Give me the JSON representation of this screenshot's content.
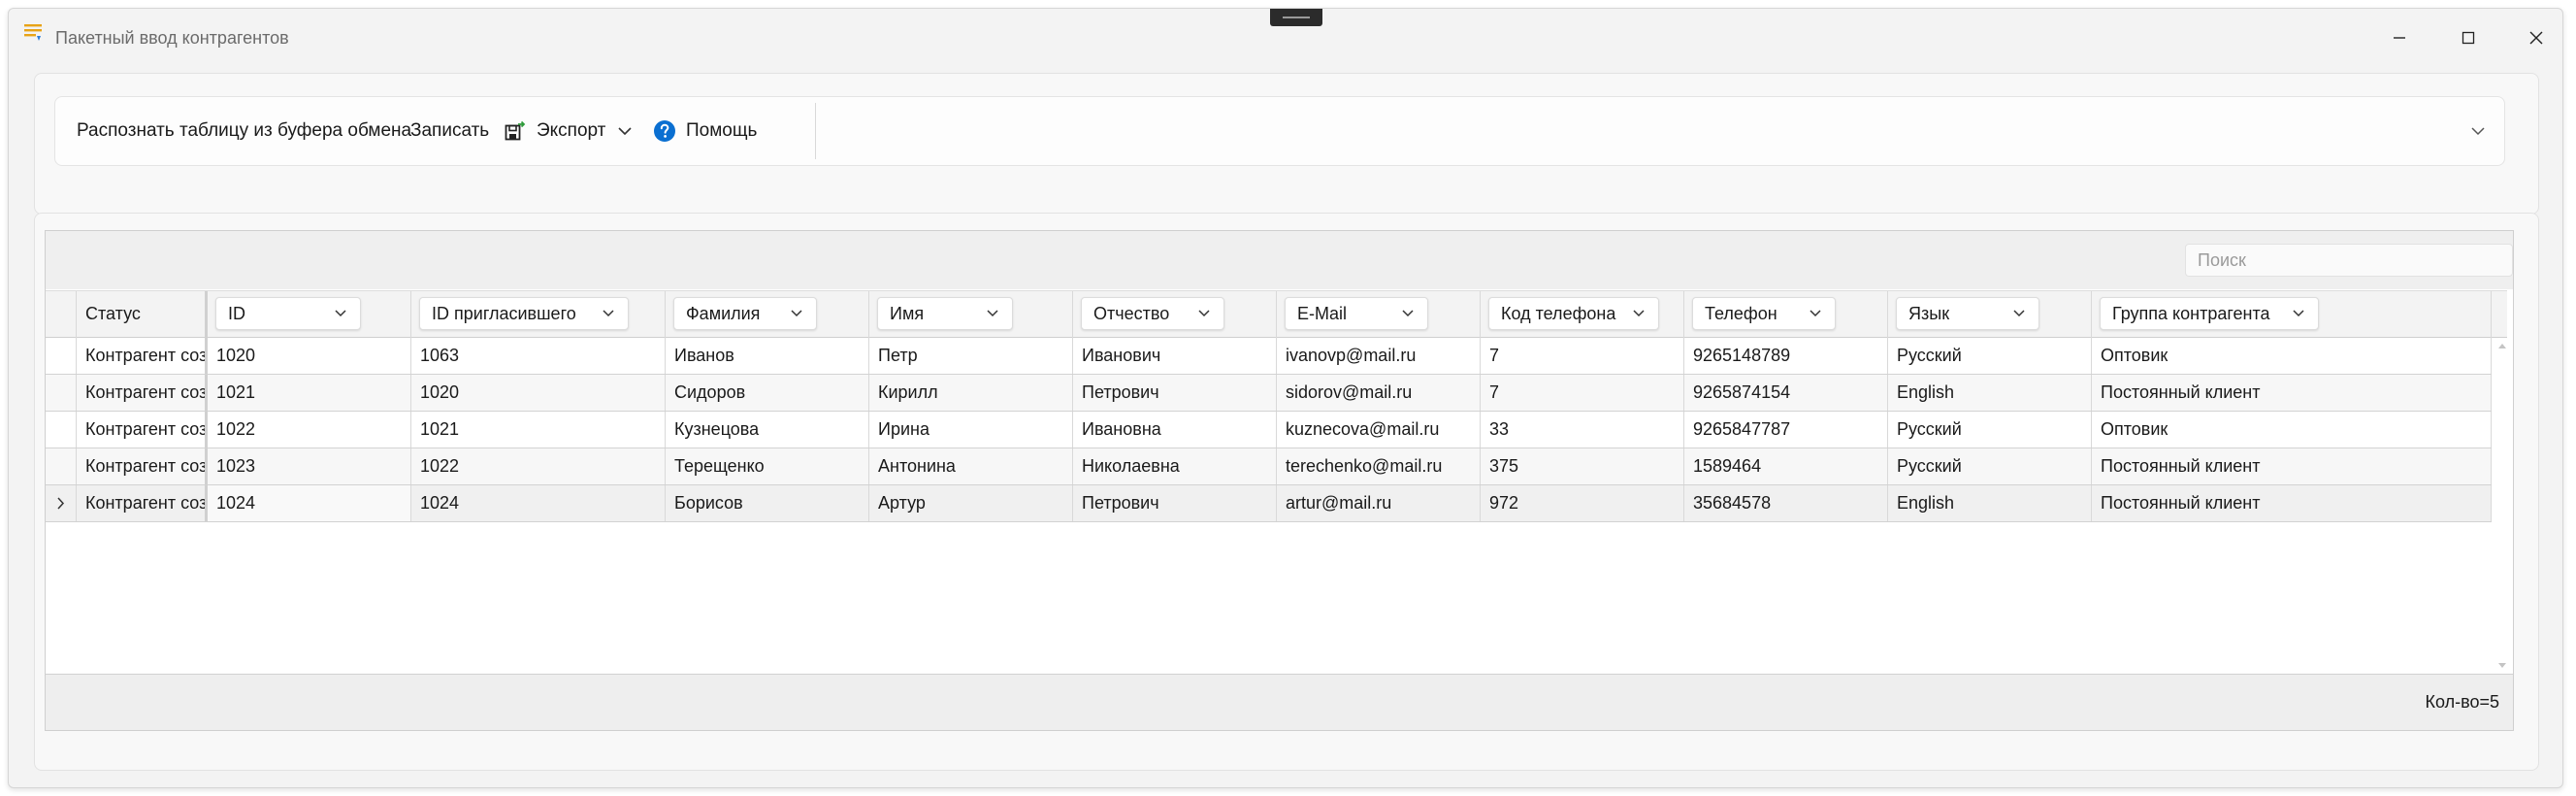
{
  "window": {
    "title": "Пакетный ввод контрагентов"
  },
  "toolbar": {
    "recognize_label": "Распознать таблицу из буфера обмена",
    "save_label": "Записать",
    "export_label": "Экспорт",
    "help_label": "Помощь"
  },
  "grid": {
    "search_placeholder": "Поиск",
    "columns": [
      "Статус",
      "ID",
      "ID пригласившего",
      "Фамилия",
      "Имя",
      "Отчество",
      "E-Mail",
      "Код телефона",
      "Телефон",
      "Язык",
      "Группа контрагента"
    ],
    "rows": [
      [
        "Контрагент создан",
        "1020",
        "1063",
        "Иванов",
        "Петр",
        "Иванович",
        "ivanovp@mail.ru",
        "7",
        "9265148789",
        "Русский",
        "Оптовик"
      ],
      [
        "Контрагент создан",
        "1021",
        "1020",
        "Сидоров",
        "Кирилл",
        "Петрович",
        "sidorov@mail.ru",
        "7",
        "9265874154",
        "English",
        "Постоянный клиент"
      ],
      [
        "Контрагент создан",
        "1022",
        "1021",
        "Кузнецова",
        "Ирина",
        "Ивановна",
        "kuznecova@mail.ru",
        "33",
        "9265847787",
        "Русский",
        "Оптовик"
      ],
      [
        "Контрагент создан",
        "1023",
        "1022",
        "Терещенко",
        "Антонина",
        "Николаевна",
        "terechenko@mail.ru",
        "375",
        "1589464",
        "Русский",
        "Постоянный клиент"
      ],
      [
        "Контрагент создан",
        "1024",
        "1024",
        "Борисов",
        "Артур",
        "Петрович",
        "artur@mail.ru",
        "972",
        "35684578",
        "English",
        "Постоянный клиент"
      ]
    ],
    "selected_row": 4,
    "count_label": "Кол-во=5"
  },
  "colors": {
    "help_icon": "#0a6fd1",
    "accent_icon": "#e8a317"
  }
}
